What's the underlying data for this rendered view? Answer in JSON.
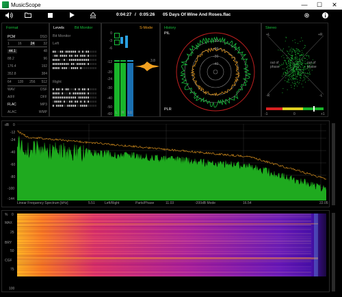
{
  "window": {
    "title": "MusicScope",
    "min": "—",
    "max": "☐",
    "close": "✕"
  },
  "toolbar": {
    "position": "0:04:27",
    "separator": "/",
    "duration": "0:05:26",
    "track": "05 Days Of Wine And Roses.flac",
    "icons": [
      "volume-icon",
      "folder-icon",
      "stop-icon",
      "play-icon",
      "eject-icon",
      "gear-icon",
      "info-icon"
    ]
  },
  "format": {
    "title": "Format",
    "header": [
      "PCM",
      "DSD"
    ],
    "bits": [
      "1",
      "16",
      "24",
      "32"
    ],
    "rates": [
      [
        "44.1",
        "48"
      ],
      [
        "88.2",
        "96"
      ],
      [
        "176.4",
        "192"
      ],
      [
        "352.8",
        "384"
      ]
    ],
    "dsd_rates": [
      "64",
      "128",
      "256",
      "512"
    ],
    "files": [
      [
        "WAV",
        "DSF"
      ],
      [
        "AIFF",
        "DFF"
      ],
      [
        "FLAC",
        "MP3"
      ],
      [
        "ALAC",
        "WMP"
      ]
    ],
    "active_rate": "44.1",
    "active_bits": "24",
    "active_file": "FLAC"
  },
  "levels": {
    "title": "Levels",
    "bit_monitor": "Bit Monitor",
    "left": "Left",
    "right": "Right",
    "scale": [
      "0",
      "-3",
      "-6",
      "-12",
      "-20",
      "-24",
      "-30",
      "-40",
      "-50",
      "-60"
    ],
    "bar_labels": [
      "L",
      "R",
      "LU"
    ],
    "peak_value": "3.8"
  },
  "smode": {
    "title": "S-Mode"
  },
  "history": {
    "title": "History",
    "pil": "PIL",
    "plr": "PLR",
    "rings": [
      "-10",
      "-20",
      "-30",
      "-40"
    ]
  },
  "stereo": {
    "title": "Stereo",
    "plus_l": "+L",
    "plus_r": "+R",
    "minus_r": "-R",
    "minus_l": "-L",
    "out_of_phase_left": "out of phase",
    "out_of_phase_right": "out of phase",
    "corr_min": "-1",
    "corr_mid": "0",
    "corr_max": "+1"
  },
  "spectrum": {
    "db_label": "dB",
    "y_ticks": [
      "0",
      "-12",
      "-24",
      "-40",
      "-60",
      "-80",
      "-100",
      "-144"
    ],
    "x_ticks": [
      "5.51",
      "11.03",
      "16.54",
      "22.05"
    ],
    "caption": "Linear Frequency Spectrum [kHz]",
    "mode_items": [
      "Left/Right",
      "Parts/Phase",
      "-200dB Mode"
    ]
  },
  "spectrogram": {
    "y_label": "%",
    "y_ticks": [
      "0",
      "25",
      "50",
      "75",
      "100"
    ],
    "left_markers": [
      "MAX",
      "BRY",
      "CGF"
    ]
  },
  "colors": {
    "accent_green": "#19c23d",
    "accent_orange": "#f0a020",
    "spectrum_fill": "#1faa1f",
    "meter_red": "#d82020",
    "meter_yellow": "#e0d020"
  }
}
